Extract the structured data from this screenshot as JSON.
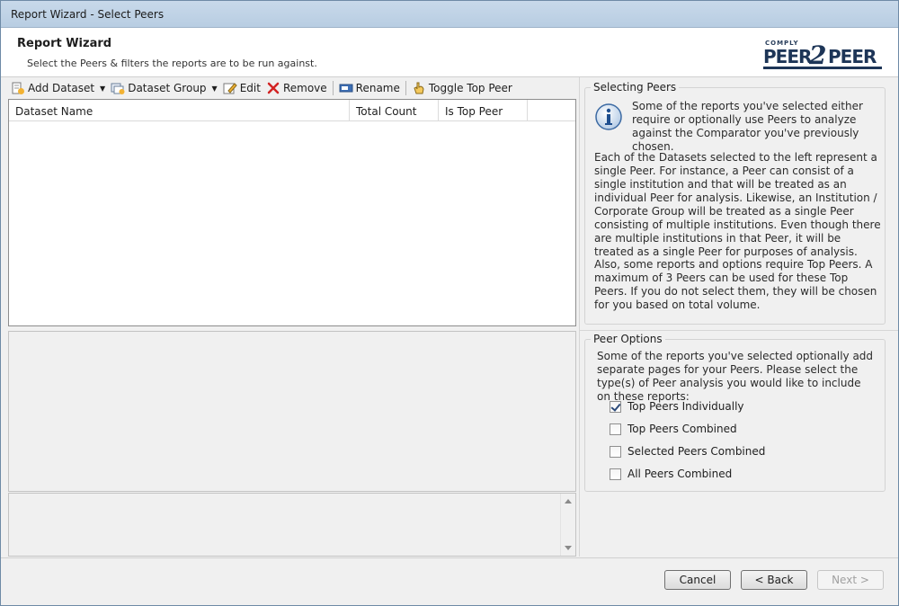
{
  "window": {
    "title": "Report Wizard - Select Peers"
  },
  "header": {
    "title": "Report Wizard",
    "subtitle": "Select the Peers & filters the reports are to be run against.",
    "logo": {
      "small": "COMPLY",
      "left": "PEER",
      "middle": "2",
      "right": "PEER"
    }
  },
  "toolbar": {
    "add_dataset": "Add Dataset",
    "dataset_group": "Dataset Group",
    "edit": "Edit",
    "remove": "Remove",
    "rename": "Rename",
    "toggle_top_peer": "Toggle Top Peer"
  },
  "grid": {
    "columns": [
      "Dataset Name",
      "Total Count",
      "Is Top Peer"
    ],
    "rows": []
  },
  "selecting_peers": {
    "legend": "Selecting Peers",
    "lead": "Some of the reports you've selected either require or optionally use Peers to analyze against the Comparator you've previously chosen.",
    "p1": "Each of the Datasets selected to the left represent a single Peer. For instance, a Peer can consist of a single institution and that will be treated as an individual Peer for analysis. Likewise, an Institution / Corporate Group will be treated as a single Peer consisting of multiple institutions. Even though there are multiple institutions in that Peer, it will be treated as a single Peer for purposes of analysis.",
    "p2": "Also, some reports and options require Top Peers. A maximum of 3 Peers can be used for these Top Peers. If you do not select them, they will be chosen for you based on total volume."
  },
  "peer_options": {
    "legend": "Peer Options",
    "text": "Some of the reports you've selected optionally add separate pages for your Peers. Please select the type(s) of Peer analysis you would like to include on these reports:",
    "options": [
      {
        "label": "Top Peers Individually",
        "checked": true
      },
      {
        "label": "Top Peers Combined",
        "checked": false
      },
      {
        "label": "Selected Peers Combined",
        "checked": false
      },
      {
        "label": "All Peers Combined",
        "checked": false
      }
    ]
  },
  "buttons": {
    "cancel": "Cancel",
    "back": "< Back",
    "next": "Next >"
  }
}
